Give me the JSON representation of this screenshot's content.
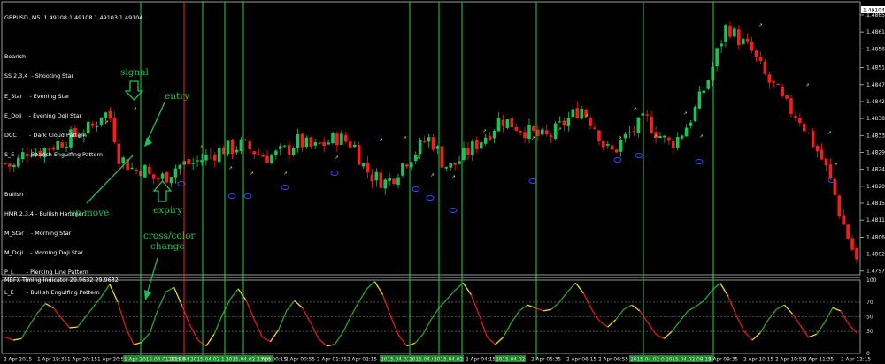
{
  "header": {
    "symbol_line": "GBPUSD.,M5  1.49108 1.49108 1.49103 1.49104"
  },
  "legend": {
    "bearish_title": "Bearish",
    "bearish_items": [
      "SS 2,3,4  - Shooting Star",
      "E_Star    - Evening Star",
      "E_Doji    - Evening Doji Star",
      "DCC       - Dark Cloud Pattern",
      "S_E       - Bearish Engulfing Pattern"
    ],
    "bullish_title": "Bullish",
    "bullish_items": [
      "HMR 2,3,4 - Bullish Hammer",
      "M_Star    - Morning Star",
      "M_Doji    - Morning Doji Star",
      "P_L       - Piercing Line Pattern",
      "L_E       - Bullish Engulfing Pattern"
    ]
  },
  "annotations": {
    "signal": "signal",
    "entry": "entry",
    "up_move": "up move",
    "expiry": "expiry",
    "cross_color_line1": "cross/color",
    "cross_color_line2": "change"
  },
  "indicator": {
    "title": "MBFX Timing Indicator 29.9632 29.9632"
  },
  "colors": {
    "background": "#000000",
    "bull_candle": "#19c35a",
    "bear_candle": "#ff1a1a",
    "vline_green": "#1fd23c",
    "vline_red": "#ff2020",
    "osc_green": "#2aa52a",
    "osc_red": "#e01818",
    "osc_yellow": "#f0e000",
    "annotation": "#19c35a"
  },
  "chart_data": [
    {
      "type": "candlestick",
      "title": "GBPUSD.,M5  1.49108 1.49108 1.49103 1.49104",
      "y_ticks": [
        "1.48655",
        "1.48610",
        "1.48565",
        "1.48515",
        "1.48470",
        "1.48425",
        "1.48380",
        "1.48335",
        "1.48290",
        "1.48245",
        "1.48200",
        "1.48155",
        "1.48110",
        "1.48065",
        "1.48020",
        "1.47975"
      ],
      "ylim": [
        1.47965,
        1.4869
      ],
      "last_price": "1.49104",
      "trend_close": [
        1.4826,
        1.4825,
        1.4828,
        1.483,
        1.4829,
        1.483,
        1.4831,
        1.4832,
        1.4833,
        1.4834,
        1.4835,
        1.4836,
        1.484,
        1.4838,
        1.4828,
        1.4826,
        1.4824,
        1.4825,
        1.4822,
        1.4822,
        1.4823,
        1.4825,
        1.4826,
        1.4826,
        1.4827,
        1.4828,
        1.4829,
        1.483,
        1.483,
        1.4831,
        1.483,
        1.4829,
        1.4828,
        1.4828,
        1.4829,
        1.483,
        1.4832,
        1.4831,
        1.483,
        1.4831,
        1.4832,
        1.4833,
        1.4832,
        1.4831,
        1.4826,
        1.4823,
        1.4822,
        1.4821,
        1.4823,
        1.4826,
        1.4828,
        1.483,
        1.4833,
        1.4831,
        1.4826,
        1.4825,
        1.4827,
        1.4829,
        1.4831,
        1.4833,
        1.4835,
        1.4838,
        1.4837,
        1.4836,
        1.4835,
        1.4834,
        1.4833,
        1.4833,
        1.4835,
        1.4837,
        1.4839,
        1.4841,
        1.4838,
        1.4835,
        1.483,
        1.4829,
        1.4832,
        1.4834,
        1.4836,
        1.4838,
        1.4835,
        1.4833,
        1.4831,
        1.4833,
        1.4836,
        1.484,
        1.4845,
        1.485,
        1.4857,
        1.4863,
        1.486,
        1.4858,
        1.4856,
        1.4852,
        1.4848,
        1.4846,
        1.4842,
        1.484,
        1.4838,
        1.4834,
        1.483,
        1.4826,
        1.482,
        1.4812,
        1.4806,
        1.48
      ],
      "annotations": [
        "signal",
        "entry",
        "up move",
        "expiry",
        "cross/color change"
      ]
    },
    {
      "type": "line",
      "title": "MBFX Timing Indicator 29.9632 29.9632",
      "y_ticks": [
        "100",
        "70",
        "50",
        "30",
        "0"
      ],
      "ylim": [
        0,
        100
      ],
      "levels": [
        70,
        50,
        30
      ],
      "values": [
        22,
        18,
        20,
        38,
        55,
        68,
        62,
        48,
        35,
        36,
        50,
        64,
        78,
        94,
        70,
        35,
        12,
        15,
        28,
        60,
        84,
        90,
        65,
        38,
        18,
        10,
        26,
        52,
        74,
        88,
        72,
        46,
        22,
        16,
        32,
        58,
        72,
        62,
        42,
        20,
        10,
        12,
        28,
        50,
        70,
        88,
        98,
        80,
        50,
        24,
        10,
        14,
        26,
        46,
        62,
        74,
        86,
        96,
        80,
        52,
        22,
        12,
        22,
        42,
        58,
        66,
        62,
        58,
        60,
        70,
        84,
        96,
        82,
        60,
        44,
        36,
        46,
        60,
        66,
        58,
        42,
        26,
        20,
        30,
        44,
        58,
        64,
        72,
        86,
        96,
        78,
        52,
        30,
        18,
        28,
        46,
        60,
        66,
        54,
        38,
        22,
        26,
        42,
        62,
        58,
        40,
        28
      ]
    }
  ],
  "x_ticks": [
    "2 Apr 2015",
    "1 Apr 19:35",
    "1 Apr 20:15",
    "1 Apr 20:55",
    "1 Apr 2015.04.01 22:00",
    "2015.04.02",
    "2015.04.02 13:05",
    "2015.04.02 23:05",
    "2 Apr 00:15",
    "2 Apr 00:55",
    "2 Apr 01:35",
    "2 Apr 02:15",
    "2015.04.02",
    "2015.04.02",
    "2015.04.02",
    "2 Apr 04:15",
    "2015.04.02",
    "2 Apr 05:35",
    "2 Apr 06:15",
    "2 Apr 06:55",
    "2015.04.02 07:35",
    "2015.04.02 08:15",
    "2 Apr 09:35",
    "2 Apr 10:15",
    "2 Apr 10:55",
    "2 Apr 11:35",
    "2 Apr 12:15"
  ]
}
